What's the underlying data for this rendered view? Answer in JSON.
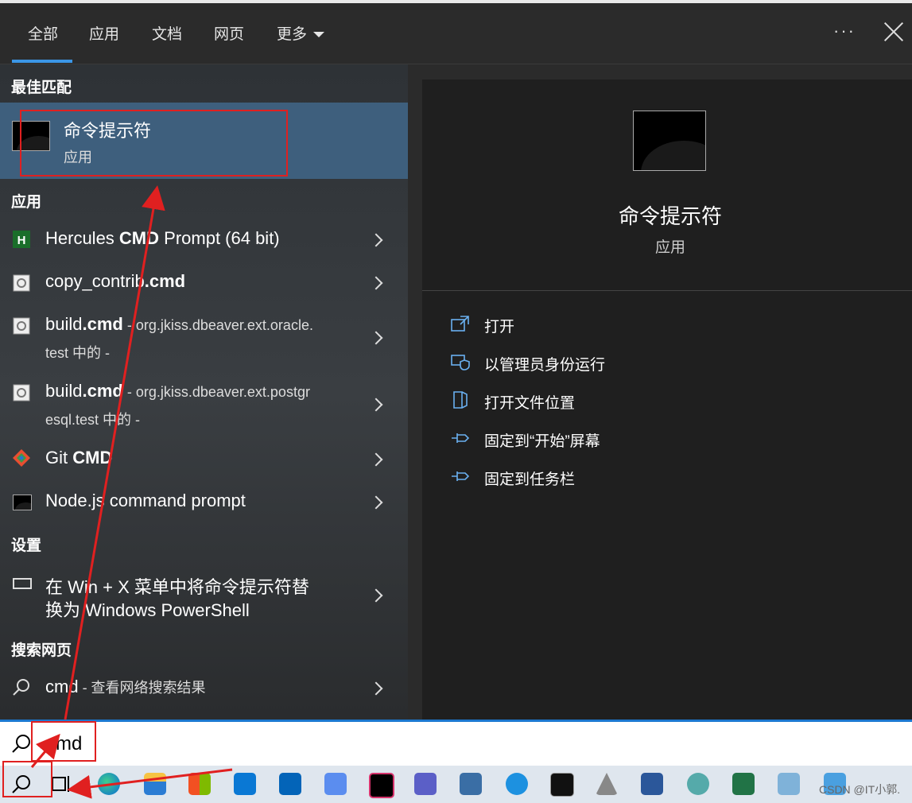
{
  "tabs": [
    {
      "label": "全部"
    },
    {
      "label": "应用"
    },
    {
      "label": "文档"
    },
    {
      "label": "网页"
    },
    {
      "label": "更多"
    }
  ],
  "window": {
    "more_options": "···"
  },
  "best_match": {
    "section": "最佳匹配",
    "title": "命令提示符",
    "subtitle": "应用"
  },
  "apps": {
    "section": "应用",
    "items": [
      {
        "pre": "Hercules ",
        "bold": "CMD",
        "post": " Prompt (64 bit)"
      },
      {
        "pre": "copy_contrib",
        "bold": ".cmd",
        "post": ""
      },
      {
        "pre": "build",
        "bold": ".cmd",
        "post": " - org.jkiss.dbeaver.ext.oracle.",
        "line2": "test 中的 -"
      },
      {
        "pre": "build",
        "bold": ".cmd",
        "post": " - org.jkiss.dbeaver.ext.postgr",
        "line2": "esql.test 中的 -"
      },
      {
        "pre": "Git ",
        "bold": "CMD",
        "post": ""
      },
      {
        "pre": "Node.js command prompt",
        "bold": "",
        "post": ""
      }
    ]
  },
  "settings": {
    "section": "设置",
    "item_line1": "在 Win + X 菜单中将命令提示符替",
    "item_line2": "换为 Windows PowerShell"
  },
  "web": {
    "section": "搜索网页",
    "query": "cmd",
    "suffix": " - 查看网络搜索结果"
  },
  "preview": {
    "title": "命令提示符",
    "subtitle": "应用",
    "actions": [
      {
        "label": "打开",
        "icon": "open-icon"
      },
      {
        "label": "以管理员身份运行",
        "icon": "shield-icon"
      },
      {
        "label": "打开文件位置",
        "icon": "folder-icon"
      },
      {
        "label": "固定到“开始”屏幕",
        "icon": "pin-icon"
      },
      {
        "label": "固定到任务栏",
        "icon": "pin-icon"
      }
    ]
  },
  "search": {
    "query": "cmd"
  },
  "watermark": "CSDN @IT小郭.",
  "colors": {
    "accent": "#3b96e6",
    "selected": "#3e5f7d",
    "annotation": "#e02020"
  }
}
